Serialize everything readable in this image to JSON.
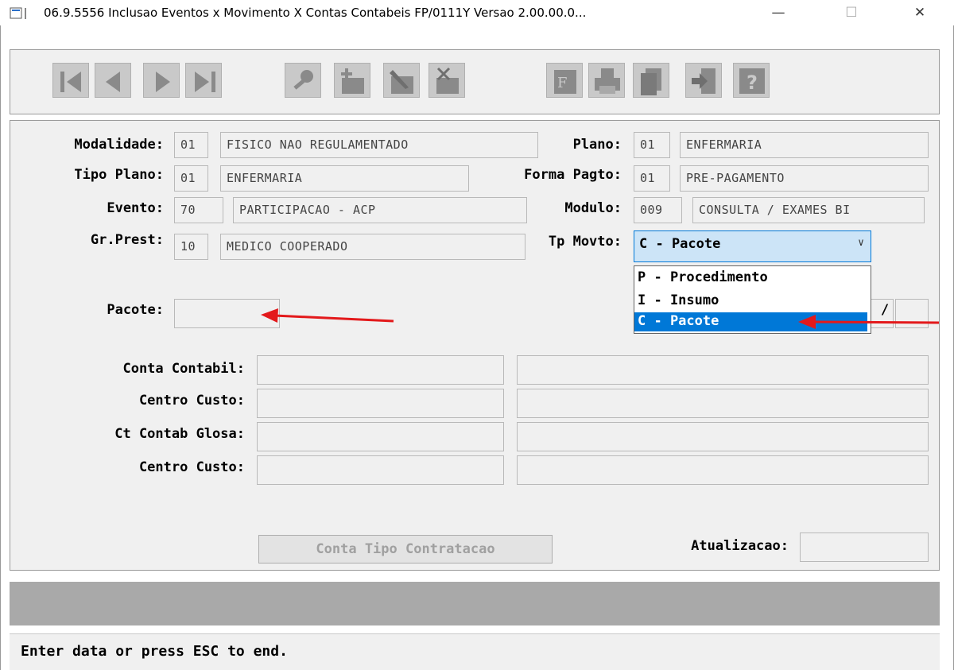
{
  "window": {
    "title": "06.9.5556  Inclusao  Eventos x Movimento X Contas Contabeis FP/0111Y Versao 2.00.00.0...",
    "minimize": "—",
    "maximize": "☐",
    "close": "✕"
  },
  "toolbar": {
    "buttons": [
      "first-record",
      "previous-record",
      "next-record",
      "last-record",
      "search",
      "add",
      "edit",
      "delete",
      "filter",
      "print",
      "copy",
      "exit",
      "help"
    ]
  },
  "form": {
    "modalidade": {
      "label": "Modalidade:",
      "code": "01",
      "desc": "FISICO NAO REGULAMENTADO"
    },
    "plano": {
      "label": "Plano:",
      "code": "01",
      "desc": "ENFERMARIA"
    },
    "tipo_plano": {
      "label": "Tipo Plano:",
      "code": "01",
      "desc": "ENFERMARIA"
    },
    "forma_pagto": {
      "label": "Forma Pagto:",
      "code": "01",
      "desc": "PRE-PAGAMENTO"
    },
    "evento": {
      "label": "Evento:",
      "code": "70",
      "desc": "PARTICIPACAO - ACP"
    },
    "modulo": {
      "label": "Modulo:",
      "code": "009",
      "desc": "CONSULTA / EXAMES BI"
    },
    "gr_prest": {
      "label": "Gr.Prest:",
      "code": "10",
      "desc": "MEDICO COOPERADO"
    },
    "tp_movto": {
      "label": "Tp Movto:",
      "selected": "C - Pacote",
      "options": [
        "P - Procedimento",
        "I - Insumo",
        "C - Pacote"
      ]
    },
    "pacote": {
      "label": "Pacote:",
      "value": ""
    },
    "separator": "/",
    "conta_contabil": {
      "label": "Conta Contabil:",
      "code": "",
      "desc": ""
    },
    "centro_custo_1": {
      "label": "Centro Custo:",
      "code": "",
      "desc": ""
    },
    "ct_contab_glosa": {
      "label": "Ct Contab Glosa:",
      "code": "",
      "desc": ""
    },
    "centro_custo_2": {
      "label": "Centro Custo:",
      "code": "",
      "desc": ""
    },
    "conta_tipo_button": "Conta Tipo Contratacao",
    "atualizacao": {
      "label": "Atualizacao:",
      "value": ""
    }
  },
  "status": {
    "message": "Enter data or press ESC to end."
  },
  "colors": {
    "selection": "#0078d7",
    "annotation_arrow": "#e3191b"
  }
}
